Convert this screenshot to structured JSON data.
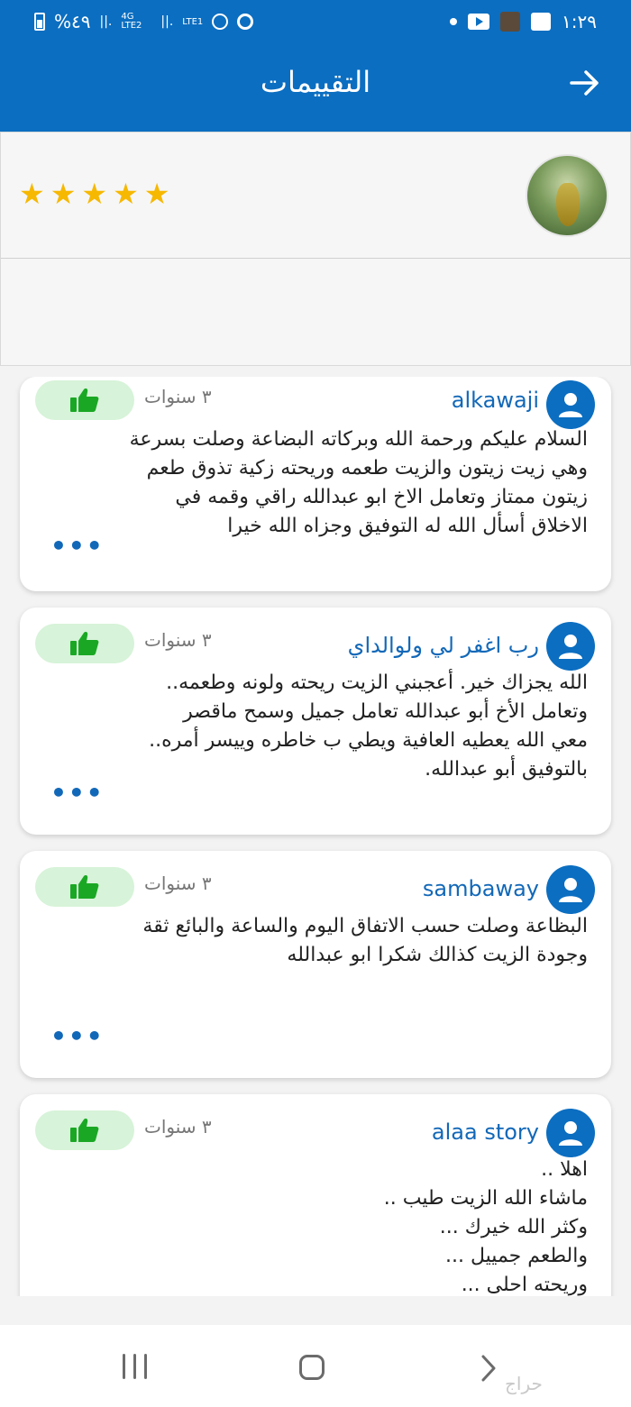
{
  "status_bar": {
    "time": "١:٢٩",
    "battery": "%٤٩",
    "network_labels": [
      "4G LTE2",
      "LTE1"
    ]
  },
  "header": {
    "title": "التقييمات"
  },
  "seller": {
    "rating_stars": 5
  },
  "reviews": [
    {
      "name": "alkawaji",
      "time": "٣ سنوات",
      "text": "السلام عليكم ورحمة الله وبركاته البضاعة وصلت بسرعة\nوهي زيت زيتون والزيت طعمه وريحته زكية تذوق طعم\nزيتون ممتاز وتعامل الاخ ابو عبدالله راقي وقمه في\nالاخلاق أسأل الله له التوفيق وجزاه الله خيرا",
      "more": "•••"
    },
    {
      "name": "رب اغفر لي ولوالداي",
      "time": "٣ سنوات",
      "text": "الله يجزاك خير. أعجبني الزيت ريحته ولونه وطعمه..\nوتعامل الأخ أبو عبدالله تعامل جميل وسمح ماقصر\nمعي الله يعطيه العافية ويطي ب خاطره وييسر أمره..\nبالتوفيق  أبو عبدالله.",
      "more": "•••"
    },
    {
      "name": "sambaway",
      "time": "٣ سنوات",
      "text": "البظاعة وصلت حسب الاتفاق اليوم والساعة والبائع ثقة\nوجودة الزيت كذالك شكرا ابو عبدالله",
      "more": "•••"
    },
    {
      "name": "alaa story",
      "time": "٣ سنوات",
      "text": "اهلا ..\nماشاء الله الزيت طيب ..\nوكثر الله خيرك ...\nوالطعم جمييل ...\nوريحته احلى ...",
      "more": ""
    }
  ],
  "watermark": "حراج",
  "colors": {
    "primary": "#0b6ec1",
    "like_bg": "#d7f3d9",
    "like_icon": "#1aa824",
    "star": "#f6b800"
  }
}
